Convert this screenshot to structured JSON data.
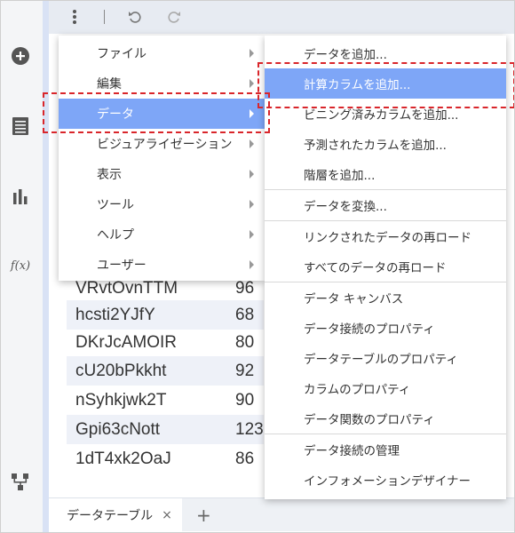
{
  "toolbar": {
    "more_icon": "vertical-ellipsis",
    "undo_icon": "undo-arrow",
    "redo_icon": "redo-arrow"
  },
  "rail": {
    "icons": [
      "add-circle-icon",
      "list-icon",
      "bar-chart-icon",
      "function-icon",
      "hierarchy-icon"
    ],
    "function_label": "f(x)"
  },
  "main_menu": {
    "items": [
      {
        "label": "ファイル"
      },
      {
        "label": "編集"
      },
      {
        "label": "データ"
      },
      {
        "label": "ビジュアライゼーション"
      },
      {
        "label": "表示"
      },
      {
        "label": "ツール"
      },
      {
        "label": "ヘルプ"
      },
      {
        "label": "ユーザー"
      }
    ]
  },
  "sub_menu": {
    "items": [
      "データを追加...",
      "計算カラムを追加...",
      "ビニング済みカラムを追加...",
      "予測されたカラムを追加...",
      "階層を追加...",
      "データを変換...",
      "リンクされたデータの再ロード",
      "すべてのデータの再ロード",
      "データ キャンバス",
      "データ接続のプロパティ",
      "データテーブルのプロパティ",
      "カラムのプロパティ",
      "データ関数のプロパティ",
      "データ接続の管理",
      "インフォメーションデザイナー"
    ]
  },
  "table": {
    "rows": [
      {
        "c1": "VRvtOvnTTM",
        "c2": "96"
      },
      {
        "c1": "hcsti2YJfY",
        "c2": "68"
      },
      {
        "c1": "DKrJcAMOIR",
        "c2": "80"
      },
      {
        "c1": "cU20bPkkht",
        "c2": "92"
      },
      {
        "c1": "nSyhkjwk2T",
        "c2": "90"
      },
      {
        "c1": "Gpi63cNott",
        "c2": "123"
      },
      {
        "c1": "1dT4xk2OaJ",
        "c2": "86"
      }
    ]
  },
  "tabbar": {
    "tab_label": "データテーブル",
    "close_glyph": "×",
    "add_glyph": "+"
  },
  "colors": {
    "highlight": "#7ea6f7",
    "annotation": "#d9262b"
  }
}
